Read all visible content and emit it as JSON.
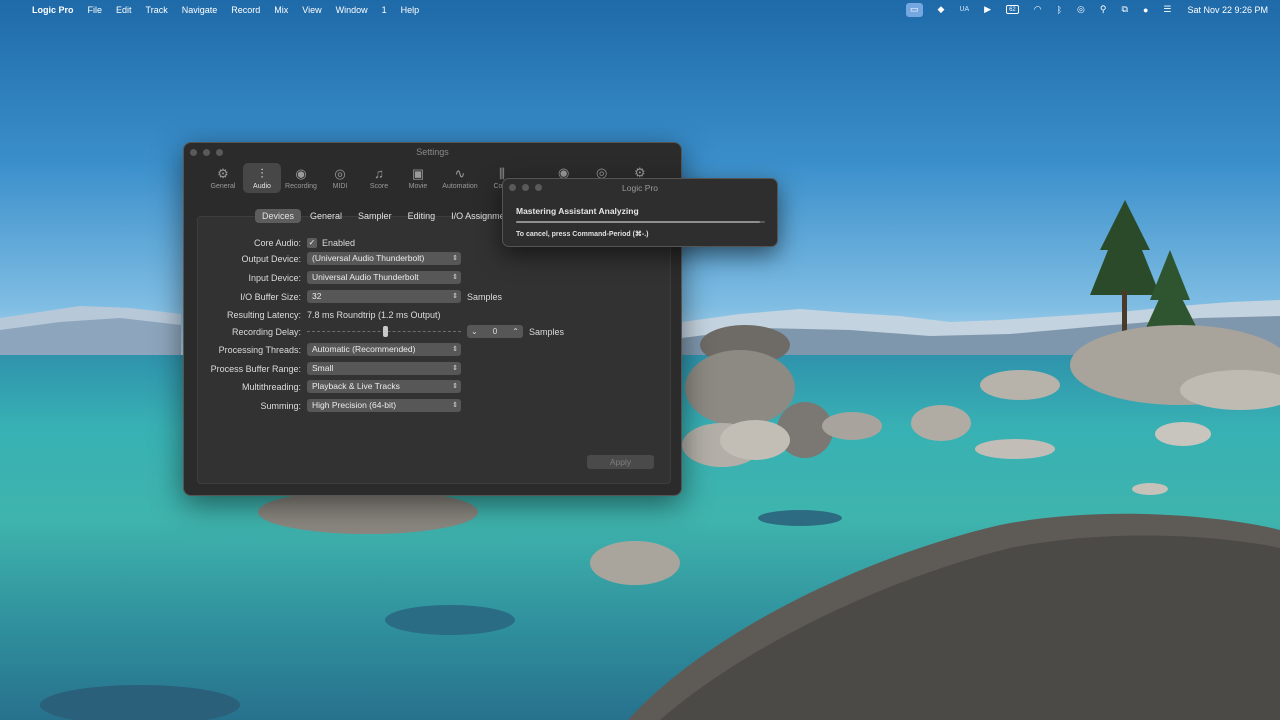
{
  "menubar": {
    "apple": "",
    "app": "Logic Pro",
    "items": [
      "File",
      "Edit",
      "Track",
      "Navigate",
      "Record",
      "Mix",
      "View",
      "Window",
      "1",
      "Help"
    ],
    "status": {
      "ua": "UA",
      "battery": "62",
      "clock": "Sat Nov 22  9:26 PM"
    }
  },
  "settings": {
    "title": "Settings",
    "toolbar": [
      {
        "label": "General",
        "icon": "gear-icon",
        "glyph": "⚙"
      },
      {
        "label": "Audio",
        "icon": "waveform-icon",
        "glyph": "⫶"
      },
      {
        "label": "Recording",
        "icon": "record-icon",
        "glyph": "◉"
      },
      {
        "label": "MIDI",
        "icon": "midi-icon",
        "glyph": "◎"
      },
      {
        "label": "Score",
        "icon": "score-icon",
        "glyph": "♫"
      },
      {
        "label": "Movie",
        "icon": "film-icon",
        "glyph": "▣"
      },
      {
        "label": "Automation",
        "icon": "automation-icon",
        "glyph": "∿"
      },
      {
        "label": "Contr",
        "icon": "controls-icon",
        "glyph": "⫼"
      }
    ],
    "active_tool": "Audio",
    "tabs": [
      "Devices",
      "General",
      "Sampler",
      "Editing",
      "I/O Assignmen"
    ],
    "active_tab": "Devices",
    "fields": {
      "core_audio": {
        "label": "Core Audio:",
        "value": "Enabled",
        "checked": true
      },
      "output_device": {
        "label": "Output Device:",
        "value": "(Universal Audio Thunderbolt)"
      },
      "input_device": {
        "label": "Input Device:",
        "value": "Universal Audio Thunderbolt"
      },
      "buffer_size": {
        "label": "I/O Buffer Size:",
        "value": "32",
        "unit": "Samples"
      },
      "latency": {
        "label": "Resulting Latency:",
        "value": "7.8 ms Roundtrip (1.2 ms Output)"
      },
      "recording_delay": {
        "label": "Recording Delay:",
        "value": "0",
        "unit": "Samples"
      },
      "processing_threads": {
        "label": "Processing Threads:",
        "value": "Automatic (Recommended)"
      },
      "buffer_range": {
        "label": "Process Buffer Range:",
        "value": "Small"
      },
      "multithreading": {
        "label": "Multithreading:",
        "value": "Playback & Live Tracks"
      },
      "summing": {
        "label": "Summing:",
        "value": "High Precision (64-bit)"
      }
    },
    "apply_label": "Apply"
  },
  "dialog": {
    "title": "Logic Pro",
    "message": "Mastering Assistant Analyzing",
    "progress": 0.98,
    "hint": "To cancel, press Command-Period (⌘-.)"
  },
  "colors": {
    "window_bg": "#2b2b2b",
    "popup_bg": "#575757",
    "sky": "#3a8fcb",
    "lake": "#3fb4ad"
  }
}
